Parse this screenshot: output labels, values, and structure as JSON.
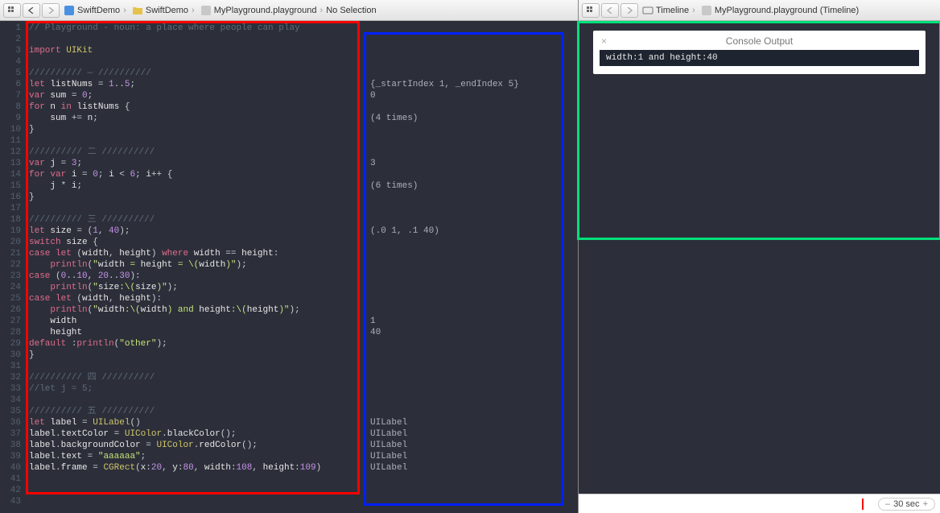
{
  "left": {
    "breadcrumb": [
      "SwiftDemo",
      "SwiftDemo",
      "MyPlayground.playground",
      "No Selection"
    ],
    "code_lines": [
      "// Playground - noun: a place where people can play",
      "",
      "import UIKit",
      "",
      "////////// — //////////",
      "let listNums = 1..5;",
      "var sum = 0;",
      "for n in listNums {",
      "    sum += n;",
      "}",
      "",
      "////////// 二 //////////",
      "var j = 3;",
      "for var i = 0; i < 6; i++ {",
      "    j * i;",
      "}",
      "",
      "////////// 三 //////////",
      "let size = (1, 40);",
      "switch size {",
      "case let (width, height) where width == height:",
      "    println(\"width = height = \\(width)\");",
      "case (0..10, 20..30):",
      "    println(\"size:\\(size)\");",
      "case let (width, height):",
      "    println(\"width:\\(width) and height:\\(height)\");",
      "    width",
      "    height",
      "default :println(\"other\");",
      "}",
      "",
      "////////// 四 //////////",
      "//let j = 5;",
      "",
      "////////// 五 //////////",
      "let label = UILabel()",
      "label.textColor = UIColor.blackColor();",
      "label.backgroundColor = UIColor.redColor();",
      "label.text = \"aaaaaa\";",
      "label.frame = CGRect(x:20, y:80, width:108, height:109)",
      "",
      "",
      ""
    ],
    "results": {
      "6": "{_startIndex 1, _endIndex 5}",
      "7": "0",
      "9": "(4 times)",
      "13": "3",
      "15": "(6 times)",
      "19": "(.0 1, .1 40)",
      "27": "1",
      "28": "40",
      "36": "UILabel",
      "37": "UILabel",
      "38": "UILabel",
      "39": "UILabel",
      "40": "UILabel"
    }
  },
  "right": {
    "breadcrumb": [
      "Timeline",
      "MyPlayground.playground (Timeline)"
    ],
    "console": {
      "title": "Console Output",
      "text": "width:1 and height:40"
    },
    "timeline_value": "30 sec"
  }
}
